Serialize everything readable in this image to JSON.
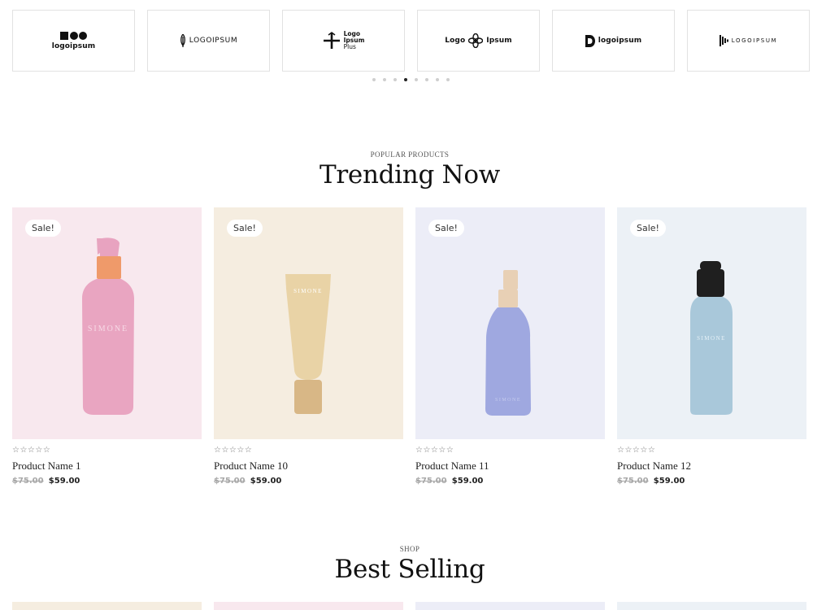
{
  "logos": [
    {
      "text": "logoipsum",
      "icon": "squares-circles-icon"
    },
    {
      "text": "LOGOIPSUM",
      "icon": "feather-icon"
    },
    {
      "text_lines": [
        "Logo",
        "Ipsum",
        "Plus"
      ],
      "icon": "cross-arrow-icon"
    },
    {
      "text_left": "Logo",
      "text_right": "Ipsum",
      "icon": "flower-icon"
    },
    {
      "text": "logoipsum",
      "icon": "d-mark-icon"
    },
    {
      "text": "LOGOIPSUM",
      "icon": "bars-icon"
    }
  ],
  "carousel": {
    "dot_count": 8,
    "active_index": 3
  },
  "trending": {
    "eyebrow": "POPULAR PRODUCTS",
    "title": "Trending Now",
    "products": [
      {
        "name": "Product Name 1",
        "old_price": "$75.00",
        "new_price": "$59.00",
        "badge": "Sale!",
        "stars": "☆☆☆☆☆",
        "bg": "#f8e8ee",
        "bottle": "pump",
        "color": "#e9a5c1",
        "cap": "#ef9a6a"
      },
      {
        "name": "Product Name 10",
        "old_price": "$75.00",
        "new_price": "$59.00",
        "badge": "Sale!",
        "stars": "☆☆☆☆☆",
        "bg": "#f5ede0",
        "bottle": "tube",
        "color": "#e9d3a6",
        "cap": "#d8b786"
      },
      {
        "name": "Product Name 11",
        "old_price": "$75.00",
        "new_price": "$59.00",
        "badge": "Sale!",
        "stars": "☆☆☆☆☆",
        "bg": "#ecedf7",
        "bottle": "spray",
        "color": "#9fa8e0",
        "cap": "#e8d0b5"
      },
      {
        "name": "Product Name 12",
        "old_price": "$75.00",
        "new_price": "$59.00",
        "badge": "Sale!",
        "stars": "☆☆☆☆☆",
        "bg": "#ecf1f6",
        "bottle": "dropper",
        "color": "#a9c8da",
        "cap": "#1f1f1f"
      }
    ]
  },
  "best_selling": {
    "eyebrow": "SHOP",
    "title": "Best Selling",
    "strip_colors": [
      "#f5ede0",
      "#f8e8ee",
      "#ecedf7",
      "#ecf1f6"
    ]
  },
  "bottle_label": "SIMONE"
}
